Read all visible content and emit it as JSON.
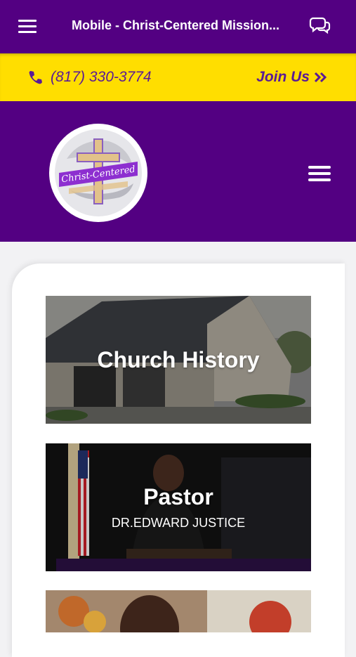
{
  "appbar": {
    "title": "Mobile - Christ-Centered Mission..."
  },
  "callbar": {
    "phone": "(817) 330-3774",
    "join_label": "Join Us"
  },
  "logo": {
    "text": "Christ-Centered"
  },
  "cards": [
    {
      "title": "Church History",
      "subtitle": ""
    },
    {
      "title": "Pastor",
      "subtitle": "DR.EDWARD JUSTICE"
    }
  ],
  "colors": {
    "primary": "#530082",
    "accent": "#ffde00",
    "link": "#5a1a96"
  },
  "icons": [
    "menu-icon",
    "chat-icon",
    "phone-icon",
    "double-chevron-right-icon",
    "hamburger-icon"
  ]
}
